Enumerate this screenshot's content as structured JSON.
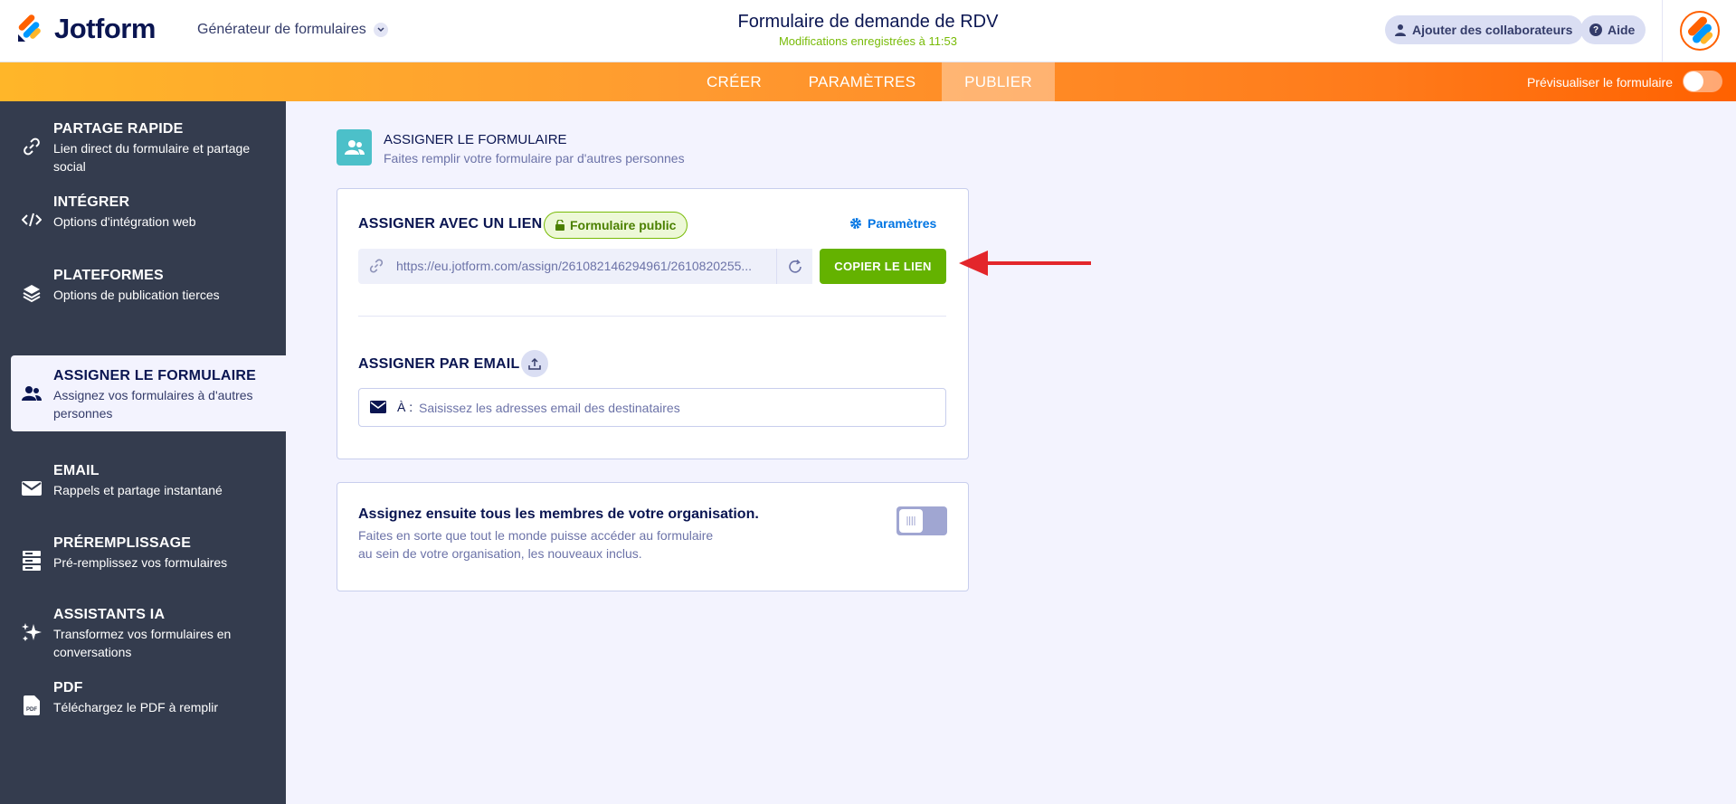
{
  "header": {
    "logo_text": "Jotform",
    "builder_label": "Générateur de formulaires",
    "form_title": "Formulaire de demande de RDV",
    "saved_status": "Modifications enregistrées à 11:53",
    "collaborators_label": "Ajouter des collaborateurs",
    "help_label": "Aide"
  },
  "nav": {
    "tabs": [
      {
        "label": "CRÉER"
      },
      {
        "label": "PARAMÈTRES"
      },
      {
        "label": "PUBLIER"
      }
    ],
    "preview_label": "Prévisualiser le formulaire"
  },
  "sidebar": {
    "items": [
      {
        "title": "PARTAGE RAPIDE",
        "desc": "Lien direct du formulaire et partage social",
        "icon": "link-icon"
      },
      {
        "title": "INTÉGRER",
        "desc": "Options d'intégration web",
        "icon": "code-icon"
      },
      {
        "title": "PLATEFORMES",
        "desc": "Options de publication tierces",
        "icon": "layers-icon"
      },
      {
        "title": "ASSIGNER LE FORMULAIRE",
        "desc": "Assignez vos formulaires à d'autres personnes",
        "icon": "users-icon"
      },
      {
        "title": "EMAIL",
        "desc": "Rappels et partage instantané",
        "icon": "envelope-icon"
      },
      {
        "title": "PRÉREMPLISSAGE",
        "desc": "Pré-remplissez vos formulaires",
        "icon": "prefill-icon"
      },
      {
        "title": "ASSISTANTS IA",
        "desc": "Transformez vos formulaires en conversations",
        "icon": "sparkle-icon"
      },
      {
        "title": "PDF",
        "desc": "Téléchargez le PDF à remplir",
        "icon": "pdf-icon"
      }
    ]
  },
  "main": {
    "section_title": "ASSIGNER LE FORMULAIRE",
    "section_subtitle": "Faites remplir votre formulaire par d'autres personnes",
    "link": {
      "label": "ASSIGNER AVEC UN LIEN",
      "public_badge": "Formulaire public",
      "settings_label": "Paramètres",
      "url": "https://eu.jotform.com/assign/261082146294961/2610820255...",
      "copy_button": "COPIER LE LIEN"
    },
    "email": {
      "label": "ASSIGNER PAR EMAIL",
      "to_label": "À :",
      "placeholder": "Saisissez les adresses email des destinataires"
    },
    "org": {
      "title": "Assignez ensuite tous les membres de votre organisation.",
      "desc": "Faites en sorte que tout le monde puisse accéder au formulaire au sein de votre organisation, les nouveaux inclus.",
      "toggle_on": false
    }
  },
  "colors": {
    "accent_orange": "#ff6100",
    "copy_green": "#64b200",
    "sidebar_bg": "#343c4e",
    "annotation_arrow": "#e3262b"
  }
}
